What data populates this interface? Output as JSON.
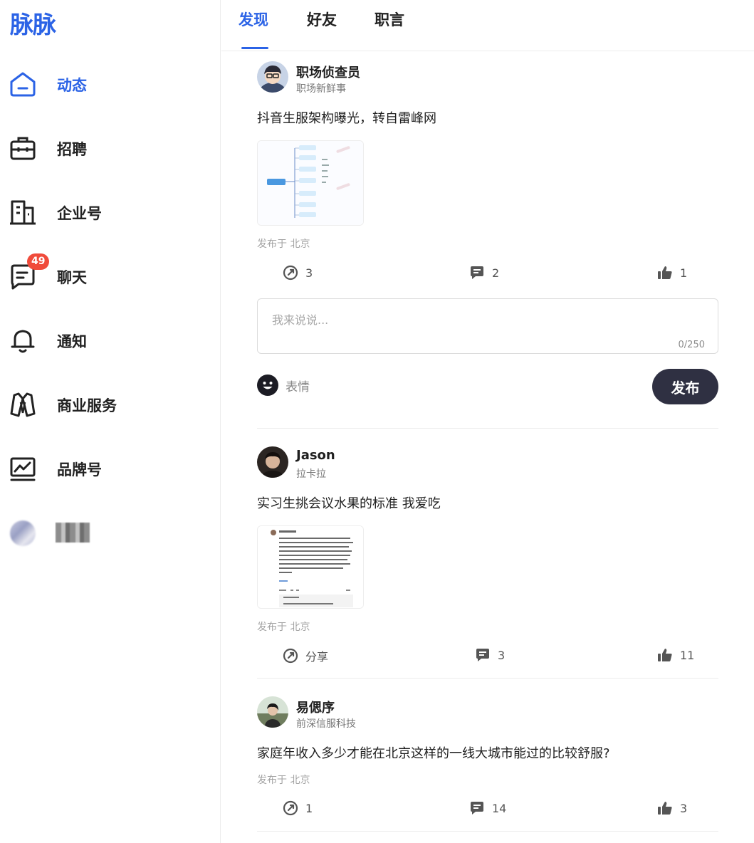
{
  "app": {
    "logo": "脉脉",
    "brand_color": "#2b63e6"
  },
  "sidebar": {
    "items": [
      {
        "label": "动态",
        "icon": "home-icon",
        "active": true
      },
      {
        "label": "招聘",
        "icon": "briefcase-icon"
      },
      {
        "label": "企业号",
        "icon": "building-icon"
      },
      {
        "label": "聊天",
        "icon": "chat-icon",
        "badge": "49"
      },
      {
        "label": "通知",
        "icon": "bell-icon"
      },
      {
        "label": "商业服务",
        "icon": "suit-icon"
      },
      {
        "label": "品牌号",
        "icon": "chart-icon"
      }
    ]
  },
  "tabs": [
    {
      "label": "发现",
      "active": true
    },
    {
      "label": "好友"
    },
    {
      "label": "职言"
    }
  ],
  "posts": [
    {
      "author": "职场侦查员",
      "subtitle": "职场新鲜事",
      "content": "抖音生服架构曝光，转自雷峰网",
      "location": "发布于 北京",
      "share": "3",
      "comments": "2",
      "likes": "1"
    },
    {
      "author": "Jason",
      "subtitle": "拉卡拉",
      "content": "实习生挑会议水果的标准 我爱吃",
      "location": "发布于 北京",
      "share": "分享",
      "comments": "3",
      "likes": "11"
    },
    {
      "author": "易偲序",
      "subtitle": "前深信服科技",
      "content": "家庭年收入多少才能在北京这样的一线大城市能过的比较舒服?",
      "location": "发布于 北京",
      "share": "1",
      "comments": "14",
      "likes": "3"
    }
  ],
  "comment_box": {
    "placeholder": "我来说说...",
    "counter": "0/250",
    "emoji_label": "表情",
    "publish_label": "发布"
  }
}
